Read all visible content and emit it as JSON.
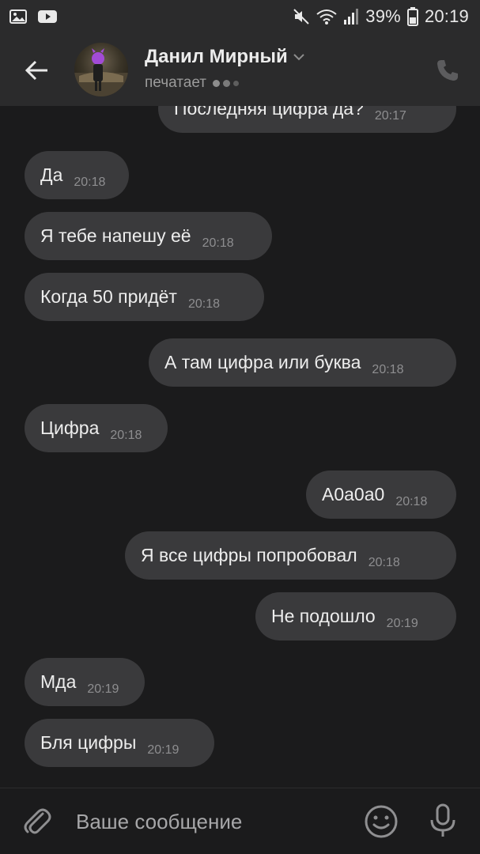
{
  "status_bar": {
    "icons_left": [
      "gallery-icon",
      "youtube-icon"
    ],
    "icons_right": [
      "mute-icon",
      "wifi-icon",
      "signal-icon",
      "battery-icon"
    ],
    "battery": "39%",
    "time": "20:19"
  },
  "header": {
    "contact_name": "Данил Мирный",
    "status": "печатает",
    "icons": [
      "back-arrow-icon",
      "avatar",
      "chevron-down-icon",
      "phone-icon"
    ]
  },
  "messages": [
    {
      "side": "out",
      "text": "Последняя цифра да?",
      "time": "20:17"
    },
    {
      "side": "in",
      "text": "Да",
      "time": "20:18"
    },
    {
      "side": "in",
      "text": "Я тебе напешу её",
      "time": "20:18"
    },
    {
      "side": "in",
      "text": "Когда 50 придёт",
      "time": "20:18"
    },
    {
      "side": "out",
      "text": "А там цифра или буква",
      "time": "20:18"
    },
    {
      "side": "in",
      "text": "Цифра",
      "time": "20:18"
    },
    {
      "side": "out",
      "text": "A0a0a0",
      "time": "20:18"
    },
    {
      "side": "out",
      "text": "Я все цифры попробовал",
      "time": "20:18"
    },
    {
      "side": "out",
      "text": "Не подошло",
      "time": "20:19"
    },
    {
      "side": "in",
      "text": "Мда",
      "time": "20:19"
    },
    {
      "side": "in",
      "text": "Бля цифры",
      "time": "20:19"
    }
  ],
  "composer": {
    "placeholder": "Ваше сообщение",
    "icons": [
      "paperclip-icon",
      "emoji-icon",
      "microphone-icon"
    ]
  },
  "colors": {
    "background": "#1b1b1c",
    "header": "#2b2b2c",
    "bubble": "#3a3a3c",
    "text": "#ededed",
    "time": "#8e8e90"
  }
}
